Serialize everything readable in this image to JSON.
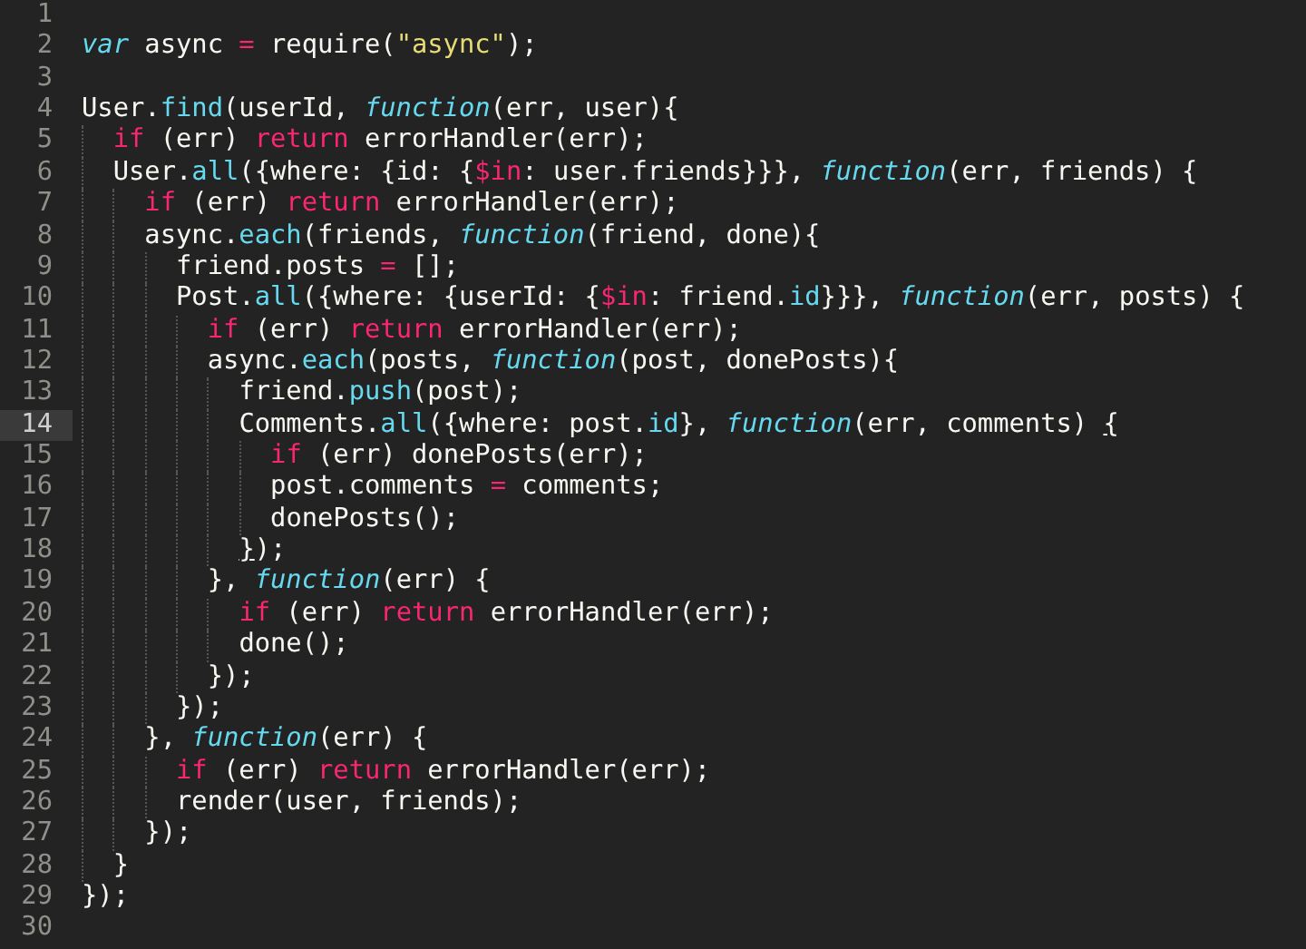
{
  "editor": {
    "lines": [
      {
        "number": "1",
        "current": false
      },
      {
        "number": "2",
        "current": false,
        "tokens": [
          {
            "text": "var",
            "kind": "storage"
          },
          {
            "text": " async ",
            "kind": "plain"
          },
          {
            "text": "=",
            "kind": "operator"
          },
          {
            "text": " require(",
            "kind": "plain"
          },
          {
            "text": "\"async\"",
            "kind": "string"
          },
          {
            "text": ");",
            "kind": "plain"
          }
        ]
      },
      {
        "number": "3",
        "current": false
      },
      {
        "number": "4",
        "current": false,
        "tokens": [
          {
            "text": "User.",
            "kind": "plain"
          },
          {
            "text": "find",
            "kind": "support"
          },
          {
            "text": "(userId, ",
            "kind": "plain"
          },
          {
            "text": "function",
            "kind": "storage"
          },
          {
            "text": "(err, user){",
            "kind": "plain"
          }
        ],
        "children": [
          {
            "number": "5",
            "current": false,
            "tokens": [
              {
                "text": "if",
                "kind": "keyword"
              },
              {
                "text": " (err) ",
                "kind": "plain"
              },
              {
                "text": "return",
                "kind": "keyword"
              },
              {
                "text": " errorHandler(err);",
                "kind": "plain"
              }
            ]
          },
          {
            "number": "6",
            "current": false,
            "tokens": [
              {
                "text": "User.",
                "kind": "plain"
              },
              {
                "text": "all",
                "kind": "support"
              },
              {
                "text": "({where: {id: {",
                "kind": "plain"
              },
              {
                "text": "$in",
                "kind": "variable"
              },
              {
                "text": ": user.friends}}}, ",
                "kind": "plain"
              },
              {
                "text": "function",
                "kind": "storage"
              },
              {
                "text": "(err, friends) {",
                "kind": "plain"
              }
            ],
            "children": [
              {
                "number": "7",
                "current": false,
                "tokens": [
                  {
                    "text": "if",
                    "kind": "keyword"
                  },
                  {
                    "text": " (err) ",
                    "kind": "plain"
                  },
                  {
                    "text": "return",
                    "kind": "keyword"
                  },
                  {
                    "text": " errorHandler(err);",
                    "kind": "plain"
                  }
                ]
              },
              {
                "number": "8",
                "current": false,
                "tokens": [
                  {
                    "text": "async.",
                    "kind": "plain"
                  },
                  {
                    "text": "each",
                    "kind": "support"
                  },
                  {
                    "text": "(friends, ",
                    "kind": "plain"
                  },
                  {
                    "text": "function",
                    "kind": "storage"
                  },
                  {
                    "text": "(friend, done){",
                    "kind": "plain"
                  }
                ],
                "children": [
                  {
                    "number": "9",
                    "current": false,
                    "tokens": [
                      {
                        "text": "friend.posts ",
                        "kind": "plain"
                      },
                      {
                        "text": "=",
                        "kind": "operator"
                      },
                      {
                        "text": " [];",
                        "kind": "plain"
                      }
                    ]
                  },
                  {
                    "number": "10",
                    "current": false,
                    "tokens": [
                      {
                        "text": "Post.",
                        "kind": "plain"
                      },
                      {
                        "text": "all",
                        "kind": "support"
                      },
                      {
                        "text": "({where: {userId: {",
                        "kind": "plain"
                      },
                      {
                        "text": "$in",
                        "kind": "variable"
                      },
                      {
                        "text": ": friend.",
                        "kind": "plain"
                      },
                      {
                        "text": "id",
                        "kind": "support"
                      },
                      {
                        "text": "}}}, ",
                        "kind": "plain"
                      },
                      {
                        "text": "function",
                        "kind": "storage"
                      },
                      {
                        "text": "(err, posts) {",
                        "kind": "plain"
                      }
                    ],
                    "children": [
                      {
                        "number": "11",
                        "current": false,
                        "tokens": [
                          {
                            "text": "if",
                            "kind": "keyword"
                          },
                          {
                            "text": " (err) ",
                            "kind": "plain"
                          },
                          {
                            "text": "return",
                            "kind": "keyword"
                          },
                          {
                            "text": " errorHandler(err);",
                            "kind": "plain"
                          }
                        ]
                      },
                      {
                        "number": "12",
                        "current": false,
                        "tokens": [
                          {
                            "text": "async.",
                            "kind": "plain"
                          },
                          {
                            "text": "each",
                            "kind": "support"
                          },
                          {
                            "text": "(posts, ",
                            "kind": "plain"
                          },
                          {
                            "text": "function",
                            "kind": "storage"
                          },
                          {
                            "text": "(post, donePosts){",
                            "kind": "plain"
                          }
                        ],
                        "children": [
                          {
                            "number": "13",
                            "current": false,
                            "tokens": [
                              {
                                "text": "friend.",
                                "kind": "plain"
                              },
                              {
                                "text": "push",
                                "kind": "support"
                              },
                              {
                                "text": "(post);",
                                "kind": "plain"
                              }
                            ]
                          },
                          {
                            "number": "14",
                            "current": true,
                            "tokens": [
                              {
                                "text": "Comments.",
                                "kind": "plain"
                              },
                              {
                                "text": "all",
                                "kind": "support"
                              },
                              {
                                "text": "({where: post.",
                                "kind": "plain"
                              },
                              {
                                "text": "id",
                                "kind": "support"
                              },
                              {
                                "text": "}, ",
                                "kind": "plain"
                              },
                              {
                                "text": "function",
                                "kind": "storage"
                              },
                              {
                                "text": "(err, comments) ",
                                "kind": "plain"
                              },
                              {
                                "text": "{",
                                "kind": "bracket-match"
                              }
                            ],
                            "children": [
                              {
                                "number": "15",
                                "current": false,
                                "tokens": [
                                  {
                                    "text": "if",
                                    "kind": "keyword"
                                  },
                                  {
                                    "text": " (err) donePosts(err);",
                                    "kind": "plain"
                                  }
                                ]
                              },
                              {
                                "number": "16",
                                "current": false,
                                "tokens": [
                                  {
                                    "text": "post.comments ",
                                    "kind": "plain"
                                  },
                                  {
                                    "text": "=",
                                    "kind": "operator"
                                  },
                                  {
                                    "text": " comments;",
                                    "kind": "plain"
                                  }
                                ]
                              },
                              {
                                "number": "17",
                                "current": false,
                                "tokens": [
                                  {
                                    "text": "donePosts();",
                                    "kind": "plain"
                                  }
                                ]
                              }
                            ]
                          },
                          {
                            "number": "18",
                            "current": false,
                            "tokens": [
                              {
                                "text": "}",
                                "kind": "bracket-match"
                              },
                              {
                                "text": ");",
                                "kind": "plain"
                              }
                            ]
                          }
                        ]
                      },
                      {
                        "number": "19",
                        "current": false,
                        "tokens": [
                          {
                            "text": "}, ",
                            "kind": "plain"
                          },
                          {
                            "text": "function",
                            "kind": "storage"
                          },
                          {
                            "text": "(err) {",
                            "kind": "plain"
                          }
                        ],
                        "children": [
                          {
                            "number": "20",
                            "current": false,
                            "tokens": [
                              {
                                "text": "if",
                                "kind": "keyword"
                              },
                              {
                                "text": " (err) ",
                                "kind": "plain"
                              },
                              {
                                "text": "return",
                                "kind": "keyword"
                              },
                              {
                                "text": " errorHandler(err);",
                                "kind": "plain"
                              }
                            ]
                          },
                          {
                            "number": "21",
                            "current": false,
                            "tokens": [
                              {
                                "text": "done();",
                                "kind": "plain"
                              }
                            ]
                          }
                        ]
                      },
                      {
                        "number": "22",
                        "current": false,
                        "tokens": [
                          {
                            "text": "});",
                            "kind": "plain"
                          }
                        ]
                      }
                    ]
                  },
                  {
                    "number": "23",
                    "current": false,
                    "tokens": [
                      {
                        "text": "});",
                        "kind": "plain"
                      }
                    ]
                  }
                ]
              },
              {
                "number": "24",
                "current": false,
                "tokens": [
                  {
                    "text": "}, ",
                    "kind": "plain"
                  },
                  {
                    "text": "function",
                    "kind": "storage"
                  },
                  {
                    "text": "(err) {",
                    "kind": "plain"
                  }
                ],
                "children": [
                  {
                    "number": "25",
                    "current": false,
                    "tokens": [
                      {
                        "text": "if",
                        "kind": "keyword"
                      },
                      {
                        "text": " (err) ",
                        "kind": "plain"
                      },
                      {
                        "text": "return",
                        "kind": "keyword"
                      },
                      {
                        "text": " errorHandler(err);",
                        "kind": "plain"
                      }
                    ]
                  },
                  {
                    "number": "26",
                    "current": false,
                    "tokens": [
                      {
                        "text": "render(user, friends);",
                        "kind": "plain"
                      }
                    ]
                  }
                ]
              },
              {
                "number": "27",
                "current": false,
                "tokens": [
                  {
                    "text": "});",
                    "kind": "plain"
                  }
                ]
              }
            ]
          },
          {
            "number": "28",
            "current": false,
            "tokens": [
              {
                "text": "}",
                "kind": "plain"
              }
            ]
          }
        ]
      },
      {
        "number": "29",
        "current": false,
        "tokens": [
          {
            "text": "});",
            "kind": "plain"
          }
        ]
      },
      {
        "number": "30",
        "current": false
      }
    ]
  }
}
